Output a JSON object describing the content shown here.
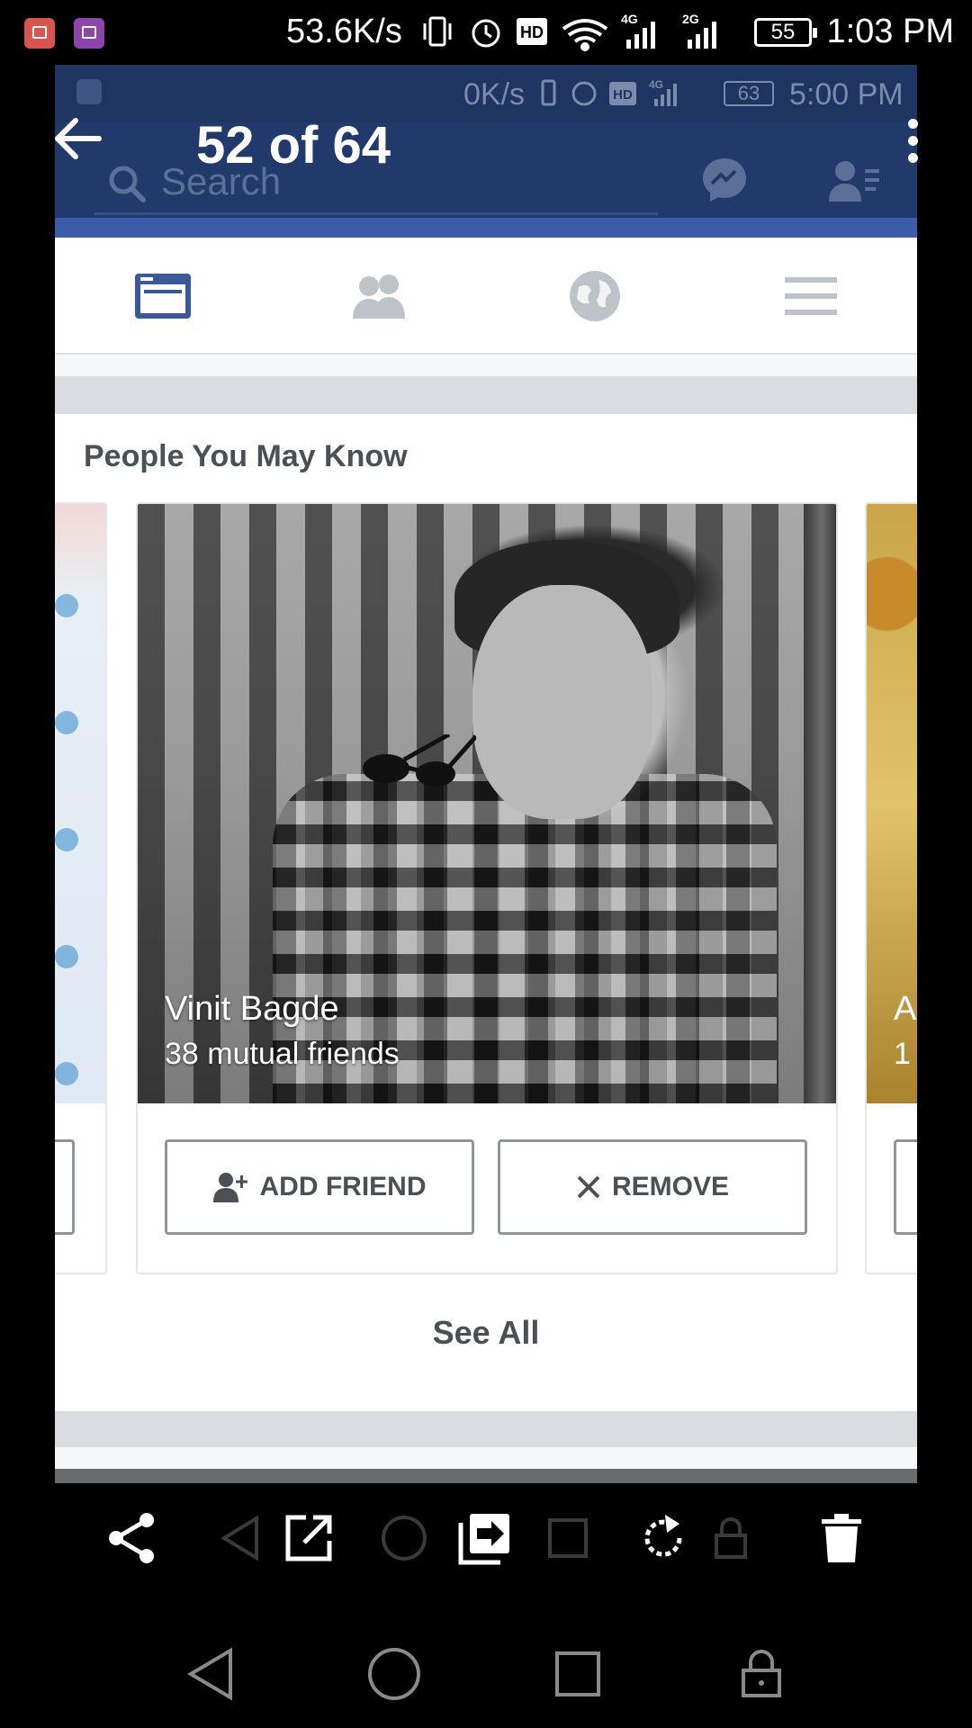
{
  "status_bar": {
    "net_speed": "53.6K/s",
    "battery": "55",
    "time": "1:03 PM",
    "net_type_1": "4G",
    "net_type_2": "2G",
    "hd": "HD"
  },
  "viewer": {
    "counter": "52 of 64"
  },
  "screenshot": {
    "inner_status": {
      "net_speed": "0K/s",
      "hd": "HD",
      "net_type": "4G",
      "battery": "63",
      "time": "5:00 PM"
    },
    "header": {
      "search_placeholder": "Search"
    },
    "tabs": [
      {
        "icon": "news-feed-icon",
        "active": true
      },
      {
        "icon": "friends-icon",
        "active": false
      },
      {
        "icon": "globe-icon",
        "active": false
      },
      {
        "icon": "menu-icon",
        "active": false
      }
    ],
    "pymk": {
      "title": "People You May Know",
      "card": {
        "name": "Vinit Bagde",
        "mutual": "38 mutual friends",
        "add_label": "ADD FRIEND",
        "remove_label": "REMOVE"
      },
      "right_card": {
        "name_partial": "A",
        "mutual_partial": "1"
      },
      "see_all": "See All"
    }
  },
  "colors": {
    "fb_dark_blue": "#223a6b",
    "fb_blue": "#3b5cab",
    "active_tab": "#3b5998",
    "inactive_icon": "#bec2c9"
  }
}
